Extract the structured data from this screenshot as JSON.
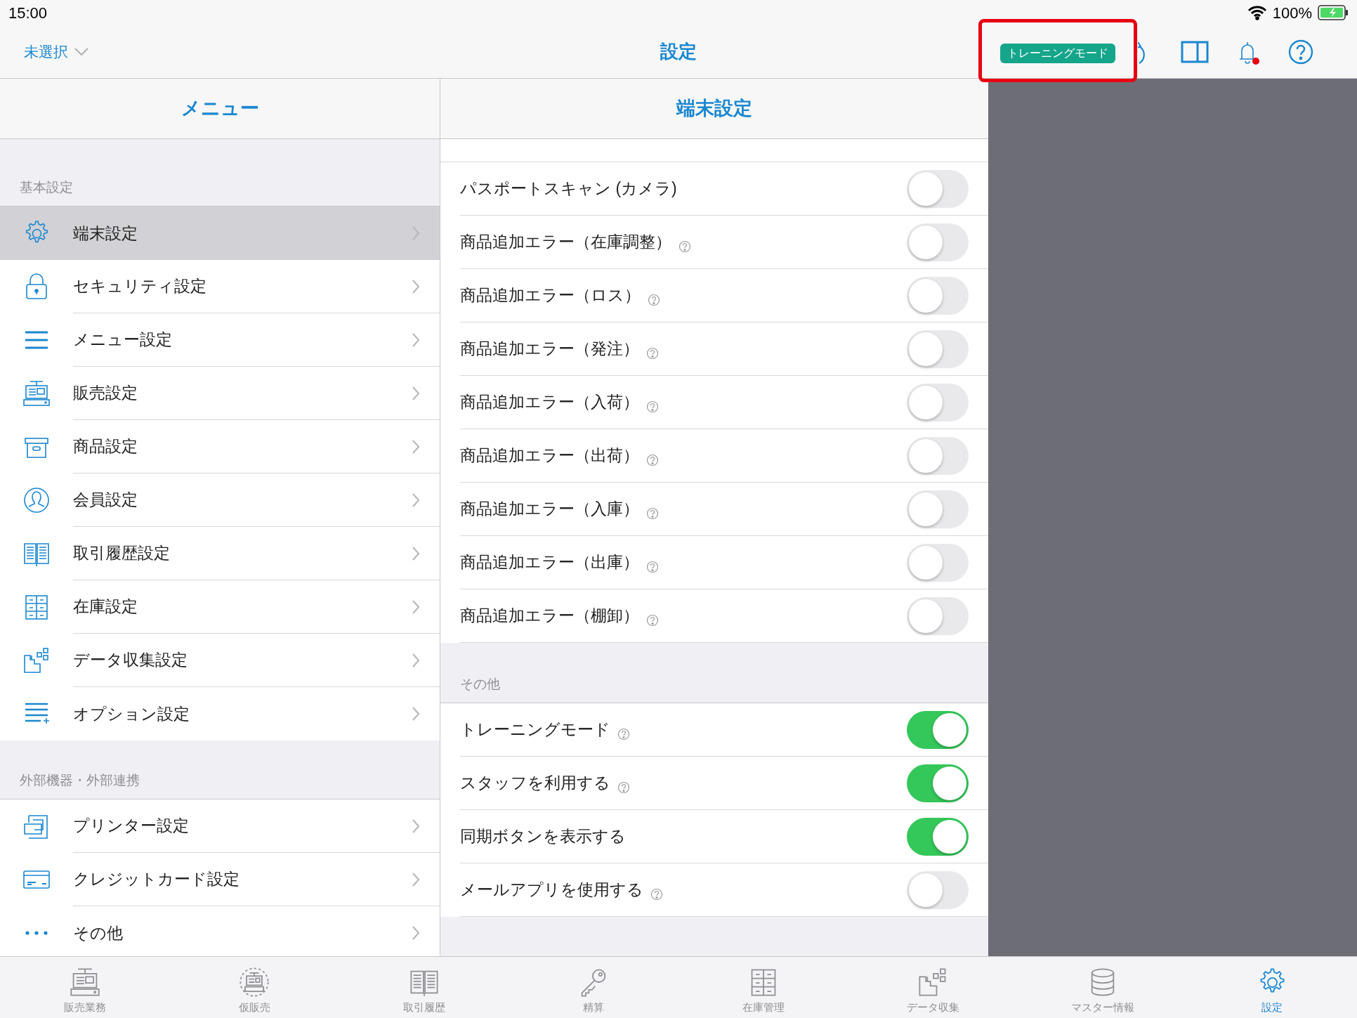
{
  "status_bar": {
    "time": "15:00",
    "battery": "100%"
  },
  "nav_bar": {
    "store_selector": "未選択",
    "title": "設定",
    "badge": "トレーニングモード"
  },
  "menu": {
    "title": "メニュー",
    "sections": [
      {
        "header": "基本設定",
        "items": [
          {
            "label": "端末設定",
            "selected": true
          },
          {
            "label": "セキュリティ設定",
            "selected": false
          },
          {
            "label": "メニュー設定",
            "selected": false
          },
          {
            "label": "販売設定",
            "selected": false
          },
          {
            "label": "商品設定",
            "selected": false
          },
          {
            "label": "会員設定",
            "selected": false
          },
          {
            "label": "取引履歴設定",
            "selected": false
          },
          {
            "label": "在庫設定",
            "selected": false
          },
          {
            "label": "データ収集設定",
            "selected": false
          },
          {
            "label": "オプション設定",
            "selected": false
          }
        ]
      },
      {
        "header": "外部機器・外部連携",
        "items": [
          {
            "label": "プリンター設定",
            "selected": false
          },
          {
            "label": "クレジットカード設定",
            "selected": false
          },
          {
            "label": "その他",
            "selected": false
          }
        ]
      }
    ]
  },
  "detail": {
    "title": "端末設定",
    "sections": [
      {
        "rows": [
          {
            "label": "パスポートスキャン (カメラ)",
            "help": false,
            "on": false
          },
          {
            "label": "商品追加エラー（在庫調整）",
            "help": true,
            "on": false
          },
          {
            "label": "商品追加エラー（ロス）",
            "help": true,
            "on": false
          },
          {
            "label": "商品追加エラー（発注）",
            "help": true,
            "on": false
          },
          {
            "label": "商品追加エラー（入荷）",
            "help": true,
            "on": false
          },
          {
            "label": "商品追加エラー（出荷）",
            "help": true,
            "on": false
          },
          {
            "label": "商品追加エラー（入庫）",
            "help": true,
            "on": false
          },
          {
            "label": "商品追加エラー（出庫）",
            "help": true,
            "on": false
          },
          {
            "label": "商品追加エラー（棚卸）",
            "help": true,
            "on": false
          }
        ]
      },
      {
        "header": "その他",
        "rows": [
          {
            "label": "トレーニングモード",
            "help": true,
            "on": true
          },
          {
            "label": "スタッフを利用する",
            "help": true,
            "on": true
          },
          {
            "label": "同期ボタンを表示する",
            "help": false,
            "on": true
          },
          {
            "label": "メールアプリを使用する",
            "help": true,
            "on": false
          }
        ]
      }
    ]
  },
  "tab_bar": [
    {
      "label": "販売業務",
      "selected": false
    },
    {
      "label": "仮販売",
      "selected": false
    },
    {
      "label": "取引履歴",
      "selected": false
    },
    {
      "label": "精算",
      "selected": false
    },
    {
      "label": "在庫管理",
      "selected": false
    },
    {
      "label": "データ収集",
      "selected": false
    },
    {
      "label": "マスター情報",
      "selected": false
    },
    {
      "label": "設定",
      "selected": true
    }
  ]
}
